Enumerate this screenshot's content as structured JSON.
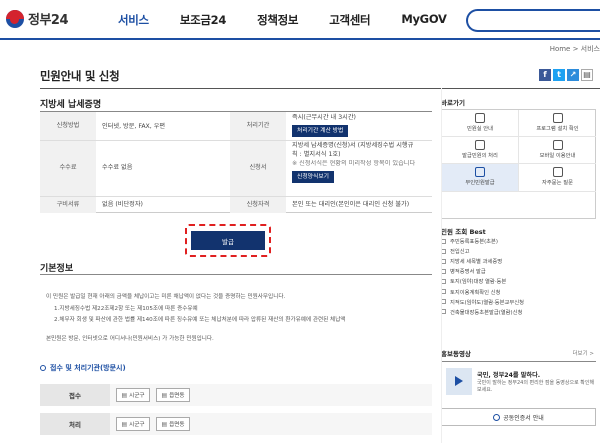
{
  "header": {
    "logo_text": "정부24",
    "nav": [
      "서비스",
      "보조금24",
      "정책정보",
      "고객센터",
      "MyGOV"
    ],
    "active_nav": "서비스"
  },
  "breadcrumb": "Home > 서비스",
  "page_title": "민원안내 및 신청",
  "section1_title": "지방세 납세증명",
  "info_table": {
    "apply_method_label": "신청방법",
    "apply_method_value": "인터넷, 방문, FAX, 우편",
    "process_period_label": "처리기간",
    "process_period_value": "즉시(근무시간 내 3시간)",
    "process_period_button": "처리기간 계산 방법",
    "fee_label": "수수료",
    "fee_value": "수수료 없음",
    "form_label": "신청서",
    "form_line1": "지방세 납세증명(신청)서 (지방세징수법 시행규",
    "form_line2": "칙 : 별지서식 1호)",
    "form_line3": "※ 신청서식은 현황의 미리작성 항목이 있습니다",
    "form_button": "신청양식보기",
    "category_label": "구비서류",
    "category_value": "없음 (비단정자)",
    "qual_label": "신청자격",
    "qual_value": "본인 또는 대리인(본인이은 대리인 신청 불가)"
  },
  "apply_button": "발급",
  "section2_title": "기본정보",
  "basic_info": [
    "이 민원은 발급일 현재 아래의 금액을 체납이고는 미른 채납액이 없다는 것을 증명하는 민원사무입니다.",
    "1.지방세징수법 제22조제2항 또는 제105조에 따른 증수유예",
    "2.체무자 회생 및 파산에 관한 법률 제140조에 따른 징수유예 또는 체납처분에 따라 압류된 재산의 환가유예에 관련된 체납액"
  ],
  "basic_info_note": "본민원은 방문, 인터넷으로 어디서나(민원서비스) 가 가능한 민원입니다.",
  "section3_title": "접수 및 처리기관(방문시)",
  "offices": [
    {
      "label": "접수",
      "buttons": [
        "시군구",
        "읍면동"
      ]
    },
    {
      "label": "처리",
      "buttons": [
        "시군구",
        "읍면동"
      ]
    }
  ],
  "quick_title": "바로가기",
  "quick_items": [
    "민원실 안내",
    "프로그램 설치 확인",
    "발급민원의 처리",
    "모바일 이용안내",
    "무인민원발급",
    "자주묻는 질문"
  ],
  "best_title": "민원 조회 Best",
  "best_items": [
    "주민등록표등본(초본)",
    "전입신고",
    "지방세 세목별 과세증명",
    "병적증명서 발급",
    "토지(임야)대장 열람·등본",
    "토지이용계획확인 신청",
    "지적도(임야도)열람·등본교부신청",
    "건축물대장등초본발급(열람)신청"
  ],
  "promo": {
    "title": "홍보동영상",
    "more": "더보기 >",
    "headline": "국민, 정부24를 말하다.",
    "desc": "국민이 말하는 정부24의 편리한 점을 동영상으로 확인해 보세요."
  },
  "cert_button": "공동인증서 안내",
  "colors": {
    "brand": "#1d4fa3",
    "dark_button": "#12336e",
    "highlight": "#e02020"
  }
}
